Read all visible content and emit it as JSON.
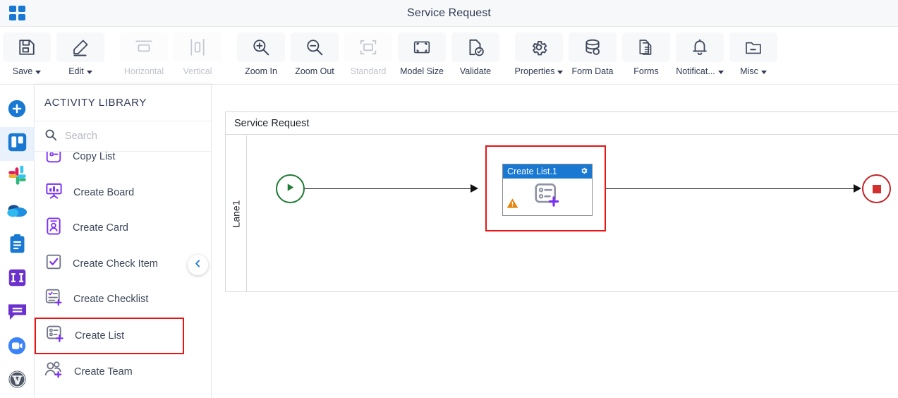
{
  "topbar": {
    "app_grid_icon": "app-grid-icon",
    "title": "Service Request"
  },
  "toolbar": {
    "buttons": [
      {
        "label": "Save",
        "icon": "save-icon",
        "caret": true,
        "disabled": false
      },
      {
        "label": "Edit",
        "icon": "pencil-icon",
        "caret": true,
        "disabled": false
      },
      {
        "label": "Horizontal",
        "icon": "horizontal-icon",
        "caret": false,
        "disabled": true
      },
      {
        "label": "Vertical",
        "icon": "vertical-icon",
        "caret": false,
        "disabled": true
      },
      {
        "label": "Zoom In",
        "icon": "zoom-in-icon",
        "caret": false,
        "disabled": false
      },
      {
        "label": "Zoom Out",
        "icon": "zoom-out-icon",
        "caret": false,
        "disabled": false
      },
      {
        "label": "Standard",
        "icon": "standard-icon",
        "caret": false,
        "disabled": true
      },
      {
        "label": "Model Size",
        "icon": "model-size-icon",
        "caret": false,
        "disabled": false
      },
      {
        "label": "Validate",
        "icon": "validate-icon",
        "caret": false,
        "disabled": false
      },
      {
        "label": "Properties",
        "icon": "gear-icon",
        "caret": true,
        "disabled": false
      },
      {
        "label": "Form Data",
        "icon": "database-icon",
        "caret": false,
        "disabled": false
      },
      {
        "label": "Forms",
        "icon": "document-icon",
        "caret": false,
        "disabled": false
      },
      {
        "label": "Notificat...",
        "icon": "bell-icon",
        "caret": true,
        "disabled": false
      },
      {
        "label": "Misc",
        "icon": "folder-icon",
        "caret": true,
        "disabled": false
      }
    ]
  },
  "rail": {
    "items": [
      {
        "name": "add-button",
        "icon": "plus-circle-icon",
        "active": false
      },
      {
        "name": "trello-app",
        "icon": "trello-icon",
        "active": true
      },
      {
        "name": "slack-app",
        "icon": "slack-icon",
        "active": false
      },
      {
        "name": "onedrive-app",
        "icon": "onedrive-icon",
        "active": false
      },
      {
        "name": "clipboard-app",
        "icon": "clipboard-icon",
        "active": false
      },
      {
        "name": "jira-app",
        "icon": "jira-icon",
        "active": false
      },
      {
        "name": "chat-app",
        "icon": "chat-icon",
        "active": false
      },
      {
        "name": "zoom-app",
        "icon": "video-camera-icon",
        "active": false
      },
      {
        "name": "wordpress-app",
        "icon": "wordpress-icon",
        "active": false
      }
    ]
  },
  "library": {
    "title": "ACTIVITY LIBRARY",
    "search": {
      "value": "",
      "placeholder": "Search",
      "icon": "search-icon"
    },
    "collapse_icon": "chevron-left-icon",
    "activities": [
      {
        "label": "Copy List",
        "icon": "copy-list-icon",
        "highlight": false,
        "clipped": true
      },
      {
        "label": "Create Board",
        "icon": "create-board-icon",
        "highlight": false,
        "clipped": false
      },
      {
        "label": "Create Card",
        "icon": "create-card-icon",
        "highlight": false,
        "clipped": false
      },
      {
        "label": "Create Check Item",
        "icon": "check-item-icon",
        "highlight": false,
        "clipped": false
      },
      {
        "label": "Create Checklist",
        "icon": "create-checklist-icon",
        "highlight": false,
        "clipped": false
      },
      {
        "label": "Create List",
        "icon": "create-list-icon",
        "highlight": true,
        "clipped": false
      },
      {
        "label": "Create Team",
        "icon": "create-team-icon",
        "highlight": false,
        "clipped": false
      }
    ]
  },
  "canvas": {
    "pool_title": "Service Request",
    "lane_label": "Lane1",
    "start_node": {
      "name": "start-event",
      "icon": "play-icon"
    },
    "end_node": {
      "name": "end-event",
      "icon": "stop-square-icon"
    },
    "task": {
      "title": "Create List.1",
      "gear_icon": "gear-icon",
      "glyph_icon": "create-list-icon",
      "warning_icon": "warning-triangle-icon",
      "selected": true
    }
  },
  "colors": {
    "accent_blue": "#1878d2",
    "selection_red": "#e81313",
    "start_green": "#1d7a32",
    "end_red": "#c02427",
    "warning_orange": "#e8830c",
    "purple": "#7b2ff2",
    "title_text": "#303a53"
  }
}
